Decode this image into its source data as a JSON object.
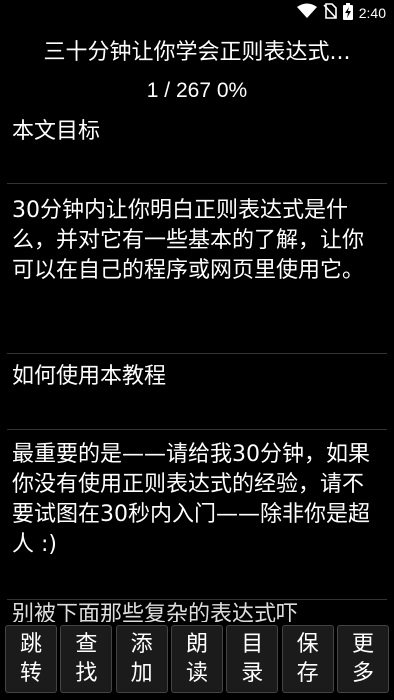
{
  "status": {
    "time": "2:40"
  },
  "header": {
    "title": "三十分钟让你学会正则表达式...",
    "progress": "1 / 267 0%"
  },
  "content": {
    "paragraphs": [
      "本文目标",
      "30分钟内让你明白正则表达式是什么，并对它有一些基本的了解，让你可以在自己的程序或网页里使用它。",
      "如何使用本教程",
      "最重要的是——请给我30分钟，如果你没有使用正则表达式的经验，请不要试图在30秒内入门——除非你是超人 :)",
      "别被下面那些复杂的表达式吓"
    ]
  },
  "toolbar": {
    "buttons": [
      {
        "line1": "跳",
        "line2": "转"
      },
      {
        "line1": "查",
        "line2": "找"
      },
      {
        "line1": "添",
        "line2": "加"
      },
      {
        "line1": "朗",
        "line2": "读"
      },
      {
        "line1": "目",
        "line2": "录"
      },
      {
        "line1": "保",
        "line2": "存"
      },
      {
        "line1": "更",
        "line2": "多"
      }
    ]
  },
  "colors": {
    "background": "#000000",
    "text": "#ffffff",
    "divider": "#333333"
  },
  "icons": [
    "wifi-icon",
    "no-sim-icon",
    "battery-charging-icon"
  ]
}
